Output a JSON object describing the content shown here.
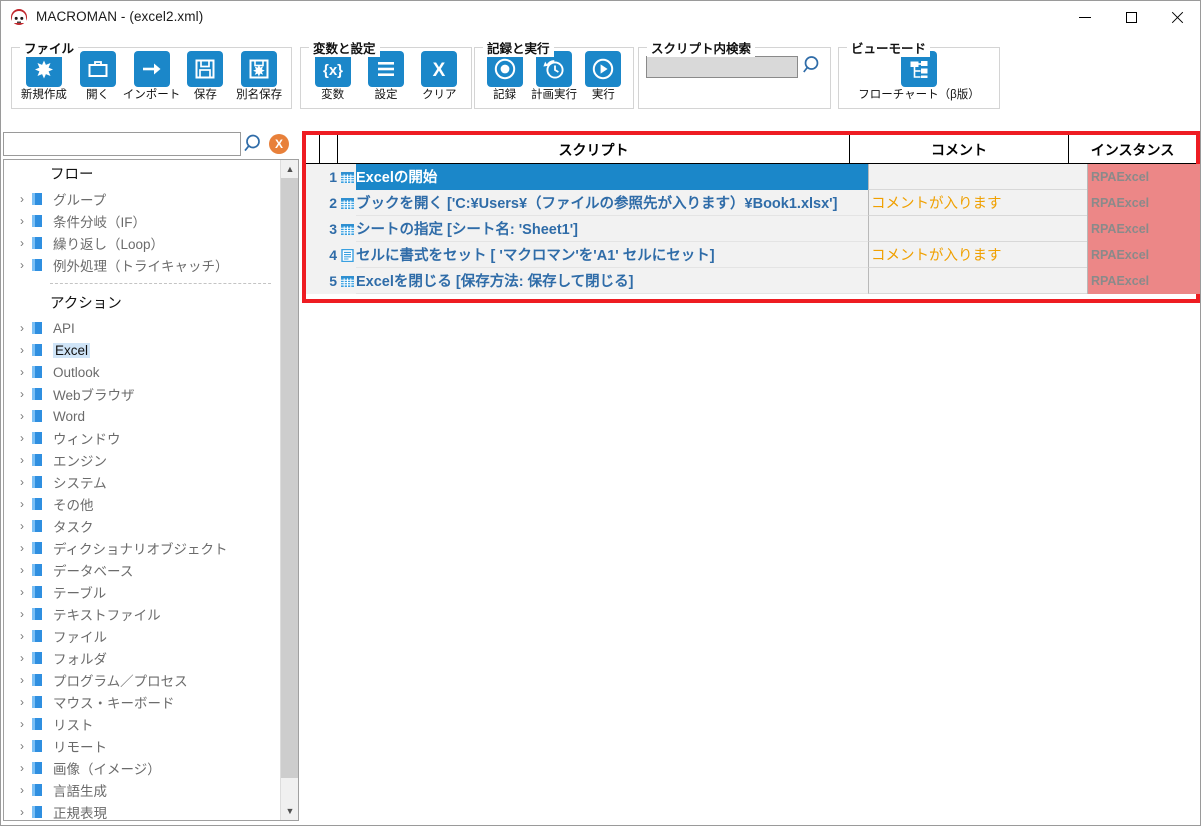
{
  "window": {
    "title": "MACROMAN - (excel2.xml)",
    "logo_icon": "macroman-logo-icon",
    "minimize_label": "─",
    "maximize_label": "□",
    "close_label": "✕"
  },
  "ribbon": {
    "groups": [
      {
        "name": "file-group",
        "title": "ファイル",
        "buttons": [
          {
            "label": "新規作成",
            "icon": "new-file-icon"
          },
          {
            "label": "開く",
            "icon": "open-folder-icon"
          },
          {
            "label": "インポート",
            "icon": "import-arrow-icon"
          },
          {
            "label": "保存",
            "icon": "save-floppy-icon"
          },
          {
            "label": "別名保存",
            "icon": "save-as-floppy-icon"
          }
        ]
      },
      {
        "name": "variables-settings-group",
        "title": "変数と設定",
        "buttons": [
          {
            "label": "変数",
            "icon": "variable-braces-icon"
          },
          {
            "label": "設定",
            "icon": "settings-lines-icon"
          },
          {
            "label": "クリア",
            "icon": "clear-x-icon"
          }
        ]
      },
      {
        "name": "record-run-group",
        "title": "記録と実行",
        "buttons": [
          {
            "label": "記録",
            "icon": "record-dot-icon"
          },
          {
            "label": "計画実行",
            "icon": "schedule-clock-icon"
          },
          {
            "label": "実行",
            "icon": "play-icon"
          }
        ]
      },
      {
        "name": "script-search-group",
        "title": "スクリプト内検索",
        "search_value": "",
        "search_placeholder": "",
        "search_icon": "search-magnifier-icon"
      },
      {
        "name": "view-mode-group",
        "title": "ビューモード",
        "buttons": [
          {
            "label": "フローチャート（β版）",
            "icon": "flowchart-icon"
          }
        ]
      }
    ]
  },
  "sidebar": {
    "search_value": "",
    "search_placeholder": "",
    "search_icon": "search-magnifier-icon",
    "clear_label": "X",
    "sections": [
      {
        "heading": "フロー",
        "items": [
          {
            "label": "グループ",
            "selected": false
          },
          {
            "label": "条件分岐（IF）",
            "selected": false
          },
          {
            "label": "繰り返し（Loop）",
            "selected": false
          },
          {
            "label": "例外処理（トライキャッチ）",
            "selected": false
          }
        ]
      },
      {
        "heading": "アクション",
        "items": [
          {
            "label": "API",
            "selected": false
          },
          {
            "label": "Excel",
            "selected": true
          },
          {
            "label": "Outlook",
            "selected": false
          },
          {
            "label": "Webブラウザ",
            "selected": false
          },
          {
            "label": "Word",
            "selected": false
          },
          {
            "label": "ウィンドウ",
            "selected": false
          },
          {
            "label": "エンジン",
            "selected": false
          },
          {
            "label": "システム",
            "selected": false
          },
          {
            "label": "その他",
            "selected": false
          },
          {
            "label": "タスク",
            "selected": false
          },
          {
            "label": "ディクショナリオブジェクト",
            "selected": false
          },
          {
            "label": "データベース",
            "selected": false
          },
          {
            "label": "テーブル",
            "selected": false
          },
          {
            "label": "テキストファイル",
            "selected": false
          },
          {
            "label": "ファイル",
            "selected": false
          },
          {
            "label": "フォルダ",
            "selected": false
          },
          {
            "label": "プログラム／プロセス",
            "selected": false
          },
          {
            "label": "マウス・キーボード",
            "selected": false
          },
          {
            "label": "リスト",
            "selected": false
          },
          {
            "label": "リモート",
            "selected": false
          },
          {
            "label": "画像（イメージ）",
            "selected": false
          },
          {
            "label": "言語生成",
            "selected": false
          },
          {
            "label": "正規表現",
            "selected": false
          }
        ]
      }
    ]
  },
  "script_table": {
    "columns": [
      "",
      "",
      "スクリプト",
      "コメント",
      "インスタンス"
    ],
    "rows": [
      {
        "num": "1",
        "icon": "excel-grid-icon",
        "script": "Excelの開始",
        "comment": "",
        "instance": "RPAExcel",
        "selected": true
      },
      {
        "num": "2",
        "icon": "excel-grid-icon",
        "script": "ブックを開く ['C:¥Users¥（ファイルの参照先が入ります）¥Book1.xlsx']",
        "comment": "コメントが入ります",
        "instance": "RPAExcel",
        "selected": false
      },
      {
        "num": "3",
        "icon": "excel-grid-icon",
        "script": "シートの指定 [シート名: 'Sheet1']",
        "comment": "",
        "instance": "RPAExcel",
        "selected": false
      },
      {
        "num": "4",
        "icon": "document-icon",
        "script": "セルに書式をセット [ 'マクロマン'を'A1' セルにセット]",
        "comment": "コメントが入ります",
        "instance": "RPAExcel",
        "selected": false
      },
      {
        "num": "5",
        "icon": "excel-grid-icon",
        "script": "Excelを閉じる [保存方法: 保存して閉じる]",
        "comment": "",
        "instance": "RPAExcel",
        "selected": false
      }
    ]
  },
  "colors": {
    "accent_blue": "#1b87c9",
    "selection_blue": "#1b87c9",
    "highlight_red_border": "#ee1c22",
    "instance_bg": "#ec8787",
    "comment_orange": "#f0a000",
    "script_text_blue": "#2f6ca8",
    "clear_button_orange": "#e8803a"
  }
}
